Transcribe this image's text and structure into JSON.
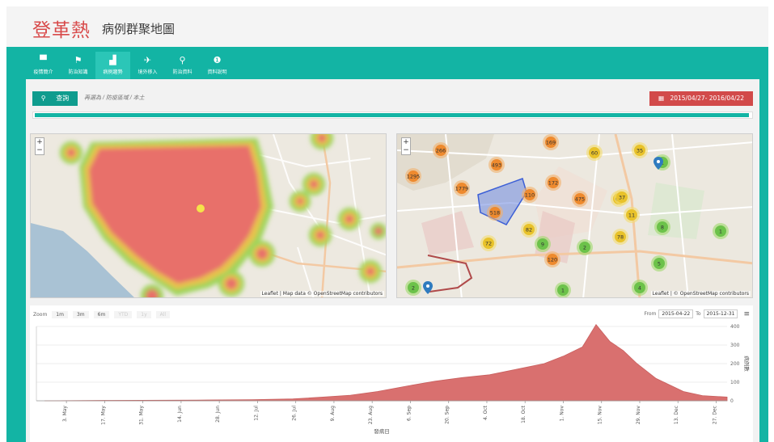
{
  "app": {
    "title_main": "登革熱",
    "title_sub": "病例群聚地圖"
  },
  "nav": [
    {
      "label": "疫情簡介",
      "icon": "bug-icon",
      "glyph": "▀"
    },
    {
      "label": "防治知識",
      "icon": "flag-icon",
      "glyph": "⚑"
    },
    {
      "label": "病例趨勢",
      "icon": "bar-chart-icon",
      "glyph": "▟",
      "active": true
    },
    {
      "label": "境外移入",
      "icon": "plane-icon",
      "glyph": "✈"
    },
    {
      "label": "防治資料",
      "icon": "spray-icon",
      "glyph": "⚲"
    },
    {
      "label": "資料說明",
      "icon": "info-icon",
      "glyph": "❶"
    }
  ],
  "toolbar": {
    "search_icon": "⚲",
    "search_label": "查詢",
    "search_placeholder": "再選為 / 防疫區域 / 本土",
    "date_icon": "▦",
    "date_range": "2015/04/27- 2016/04/22"
  },
  "slider": {
    "fill_fraction": 1.0
  },
  "heat_map": {
    "zoom_in": "+",
    "zoom_out": "−",
    "attribution": "Leaflet | Map data © OpenStreetMap contributors"
  },
  "cluster_map": {
    "zoom_in": "+",
    "zoom_out": "−",
    "attribution": "Leaflet | © OpenStreetMap contributors",
    "cluster_labels": [
      "169",
      "266",
      "1295",
      "493",
      "1779",
      "172",
      "518",
      "110",
      "82",
      "475",
      "72",
      "120",
      "60",
      "66",
      "35",
      "37",
      "78",
      "9",
      "8",
      "2",
      "5",
      "1",
      "11",
      "1",
      "4",
      "2",
      "1"
    ]
  },
  "highstock": {
    "zoom_label": "Zoom",
    "zoom_buttons": [
      "1m",
      "3m",
      "6m",
      "YTD",
      "1y",
      "All"
    ],
    "from_label": "From",
    "from_value": "2015-04-22",
    "to_label": "To",
    "to_value": "2015-12-31",
    "menu_icon": "≡",
    "y_axis_label": "病例數",
    "x_axis_label": "發病日"
  },
  "chart_data": {
    "type": "area",
    "ylabel": "病例數",
    "xlabel": "發病日",
    "ylim": [
      0,
      400
    ],
    "y_ticks": [
      0,
      100,
      200,
      300,
      400
    ],
    "x_ticks": [
      "3. May",
      "17. May",
      "31. May",
      "14. Jun",
      "28. Jun",
      "12. Jul",
      "26. Jul",
      "9. Aug",
      "23. Aug",
      "6. Sep",
      "20. Sep",
      "4. Oct",
      "18. Oct",
      "1. Nov",
      "15. Nov",
      "29. Nov",
      "13. Dec",
      "27. Dec"
    ],
    "x": [
      "2015-04-25",
      "2015-05-20",
      "2015-06-20",
      "2015-07-10",
      "2015-07-25",
      "2015-08-05",
      "2015-08-15",
      "2015-08-25",
      "2015-09-05",
      "2015-09-15",
      "2015-09-25",
      "2015-10-05",
      "2015-10-15",
      "2015-10-25",
      "2015-11-01",
      "2015-11-08",
      "2015-11-13",
      "2015-11-18",
      "2015-11-23",
      "2015-11-28",
      "2015-12-05",
      "2015-12-15",
      "2015-12-22",
      "2015-12-31"
    ],
    "values": [
      0,
      2,
      4,
      6,
      10,
      20,
      30,
      50,
      80,
      105,
      125,
      140,
      170,
      200,
      240,
      290,
      410,
      320,
      270,
      200,
      120,
      50,
      28,
      20
    ],
    "color": "#d9706f"
  },
  "colors": {
    "teal": "#13b4a4",
    "date_red": "#d24a4a",
    "title_red": "#d84a4a"
  }
}
